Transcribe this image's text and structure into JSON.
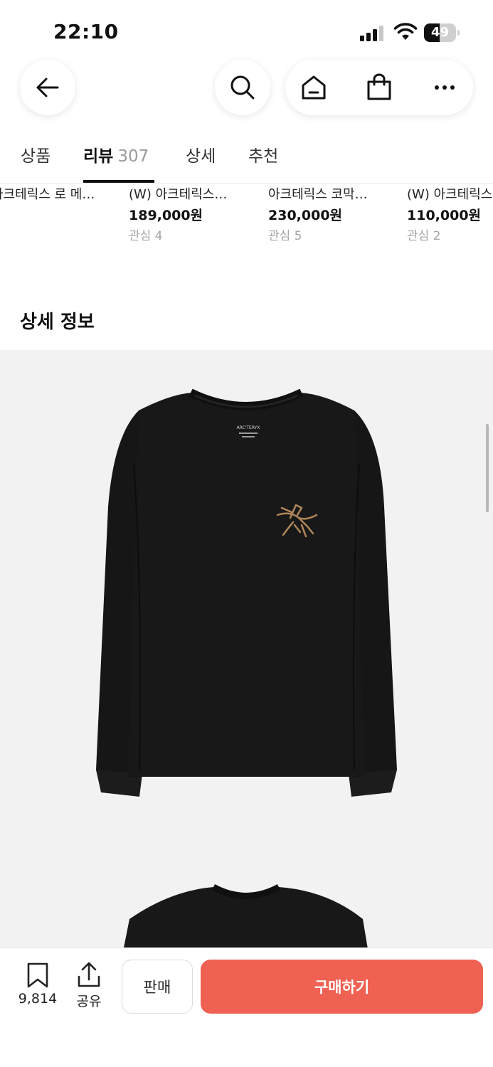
{
  "status_bar": {
    "time": "22:10",
    "battery": "49",
    "battery_level": 0.49
  },
  "nav": {
    "back_icon": "arrow-left-icon",
    "search_icon": "search-icon",
    "home_icon": "home-icon",
    "cart_icon": "shopping-bag-icon",
    "more_icon": "more-horizontal-icon"
  },
  "tabs": [
    {
      "label": "상품",
      "count": ""
    },
    {
      "label": "리뷰",
      "count": "307"
    },
    {
      "label": "상세",
      "count": ""
    },
    {
      "label": "추천",
      "count": ""
    }
  ],
  "related_products": [
    {
      "name": "아크테릭스 로 메…",
      "price": "",
      "likes": ""
    },
    {
      "name": "(W) 아크테릭스…",
      "price": "189,000원",
      "likes": "관심 4"
    },
    {
      "name": "아크테릭스 코막…",
      "price": "230,000원",
      "likes": "관심 5"
    },
    {
      "name": "(W) 아크테릭스",
      "price": "110,000원",
      "likes": "관심 2"
    }
  ],
  "detail_section": {
    "title": "상세 정보"
  },
  "product_image": {
    "logo_text": "ARC'TERYX",
    "garment_color": "#161616",
    "logo_color": "#b0875a"
  },
  "bottom_bar": {
    "bookmark_count": "9,814",
    "share_label": "공유",
    "sell_label": "판매",
    "buy_label": "구매하기",
    "buy_color": "#ef6153"
  }
}
